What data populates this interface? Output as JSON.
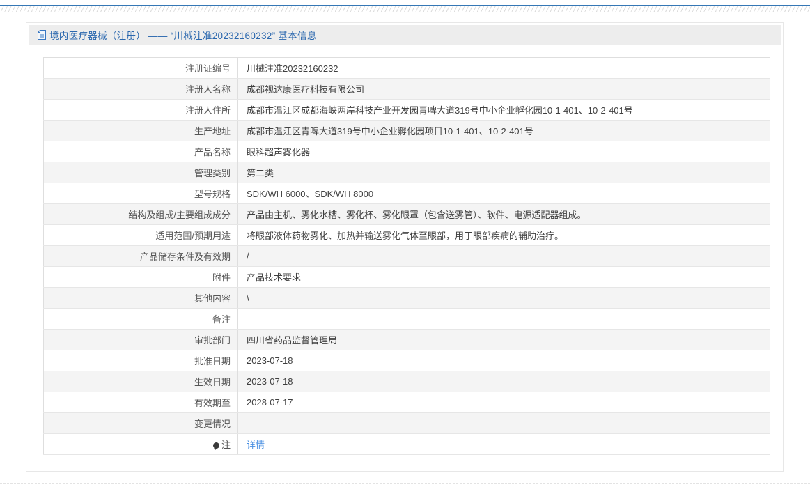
{
  "header": {
    "title": "境内医疗器械（注册） —— “川械注准20232160232” 基本信息",
    "title_icon": "document-icon"
  },
  "accent_colors": {
    "title_text": "#2a67ae",
    "link": "#4a90e2",
    "top_line": "#3577b5",
    "bottom_bar": "#1667ad",
    "title_bar_bg": "#ededed",
    "alt_row_bg": "#f4f4f4"
  },
  "table": {
    "rows": [
      {
        "label": "注册证编号",
        "value": "川械注准20232160232"
      },
      {
        "label": "注册人名称",
        "value": "成都视达康医疗科技有限公司"
      },
      {
        "label": "注册人住所",
        "value": "成都市温江区成都海峡两岸科技产业开发园青啤大道319号中小企业孵化园10-1-401、10-2-401号"
      },
      {
        "label": "生产地址",
        "value": "成都市温江区青啤大道319号中小企业孵化园项目10-1-401、10-2-401号"
      },
      {
        "label": "产品名称",
        "value": "眼科超声雾化器"
      },
      {
        "label": "管理类别",
        "value": "第二类"
      },
      {
        "label": "型号规格",
        "value": "SDK/WH 6000、SDK/WH 8000"
      },
      {
        "label": "结构及组成/主要组成成分",
        "value": "产品由主机、雾化水槽、雾化杯、雾化眼罩（包含送雾管）、软件、电源适配器组成。"
      },
      {
        "label": "适用范围/预期用途",
        "value": "将眼部液体药物雾化、加热并输送雾化气体至眼部，用于眼部疾病的辅助治疗。"
      },
      {
        "label": "产品储存条件及有效期",
        "value": "/"
      },
      {
        "label": "附件",
        "value": "产品技术要求"
      },
      {
        "label": "其他内容",
        "value": "\\"
      },
      {
        "label": "备注",
        "value": ""
      },
      {
        "label": "审批部门",
        "value": "四川省药品监督管理局"
      },
      {
        "label": "批准日期",
        "value": "2023-07-18"
      },
      {
        "label": "生效日期",
        "value": "2023-07-18"
      },
      {
        "label": "有效期至",
        "value": "2028-07-17"
      },
      {
        "label": "变更情况",
        "value": ""
      },
      {
        "label": "注",
        "icon": "comment-note-icon",
        "value": "详情",
        "is_link": true
      }
    ]
  }
}
